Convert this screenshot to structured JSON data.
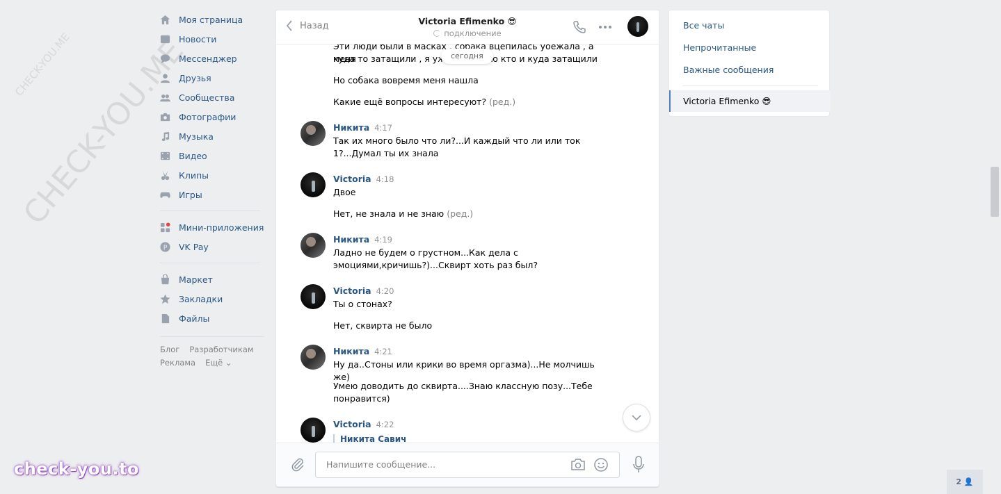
{
  "watermark": {
    "small": "CHECK-YOU.ME",
    "big": "CHECK-YOU.ME",
    "brand": "check-you.to"
  },
  "nav": {
    "items": [
      {
        "label": "Моя страница",
        "icon": "home-icon"
      },
      {
        "label": "Новости",
        "icon": "news-icon"
      },
      {
        "label": "Мессенджер",
        "icon": "messenger-icon"
      },
      {
        "label": "Друзья",
        "icon": "friends-icon"
      },
      {
        "label": "Сообщества",
        "icon": "communities-icon"
      },
      {
        "label": "Фотографии",
        "icon": "camera-icon"
      },
      {
        "label": "Музыка",
        "icon": "music-icon"
      },
      {
        "label": "Видео",
        "icon": "video-icon"
      },
      {
        "label": "Клипы",
        "icon": "clips-icon"
      },
      {
        "label": "Игры",
        "icon": "gamepad-icon"
      }
    ],
    "apps": [
      {
        "label": "Мини-приложения",
        "icon": "apps-icon"
      },
      {
        "label": "VK Pay",
        "icon": "vkpay-icon"
      }
    ],
    "extra": [
      {
        "label": "Маркет",
        "icon": "market-bag-icon"
      },
      {
        "label": "Закладки",
        "icon": "star-icon"
      },
      {
        "label": "Файлы",
        "icon": "file-icon"
      }
    ],
    "footer": [
      "Блог",
      "Разработчикам",
      "Реклама",
      "Ещё ⌄"
    ]
  },
  "header": {
    "back": "Назад",
    "peer_name": "Victoria Efimenko 😎",
    "status": "подключение"
  },
  "today_label": "сегодня",
  "messages": {
    "prev_line1": "Эти люди были в масках , собака вцепилась уоежала , а меня",
    "prev_line2": "куда то затащили , я уже не помню кто и куда затащили",
    "prev_line3": "Но собака вовремя меня нашла",
    "prev_line4": "Какие ещё вопросы интересуют?",
    "edited": "(ред.)",
    "m1": {
      "name": "Никита",
      "time": "4:17",
      "line1": "Так их много было что ли?...И каждый что ли или ток",
      "line2": "1?...Думал ты их знала"
    },
    "m2": {
      "name": "Victoria",
      "time": "4:18",
      "line1": "Двое",
      "line2": "Нет, не знала и не знаю"
    },
    "m3": {
      "name": "Никита",
      "time": "4:19",
      "line1": "Ладно не будем о грустном...Как дела с",
      "line2": "эмоциями,кричишь?)...Сквирт хоть раз был?"
    },
    "m4": {
      "name": "Victoria",
      "time": "4:20",
      "line1": "Ты о стонах?",
      "line2": "Нет, сквирта не было"
    },
    "m5": {
      "name": "Никита",
      "time": "4:21",
      "line1": "Ну да..Стоны или крики во время оргазма)...Не молчишь же)",
      "line2": "Умею доводить до сквирта....Знаю классную позу...Тебе",
      "line3": "понравится)"
    },
    "m6": {
      "name": "Victoria",
      "time": "4:22",
      "reply_name": "Никита Савич"
    }
  },
  "composer": {
    "placeholder": "Напишите сообщение..."
  },
  "right_panel": {
    "all_chats": "Все чаты",
    "unread": "Непрочитанные",
    "important": "Важные сообщения",
    "active_chat": "Victoria Efimenko 😎"
  },
  "counter": "2 👤"
}
